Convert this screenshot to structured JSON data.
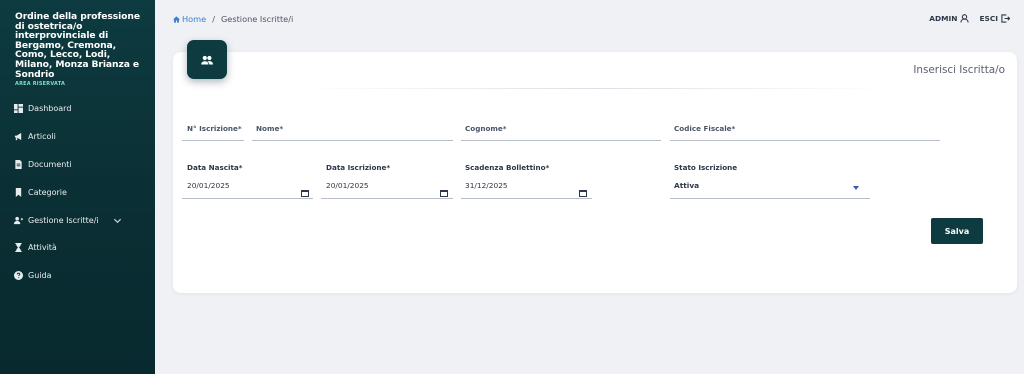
{
  "sidebar": {
    "brand_title": "Ordine della professione di ostetrica/o interprovinciale di Bergamo, Cremona, Como, Lecco, Lodi, Milano, Monza Brianza e Sondrio",
    "brand_sub": "AREA RISERVATA",
    "items": [
      {
        "label": "Dashboard",
        "icon": "dashboard-icon"
      },
      {
        "label": "Articoli",
        "icon": "megaphone-icon"
      },
      {
        "label": "Documenti",
        "icon": "document-icon"
      },
      {
        "label": "Categorie",
        "icon": "bookmark-icon"
      },
      {
        "label": "Gestione Iscritte/i",
        "icon": "users-icon"
      },
      {
        "label": "Attività",
        "icon": "hourglass-icon"
      },
      {
        "label": "Guida",
        "icon": "help-icon"
      }
    ]
  },
  "breadcrumb": {
    "home": "Home",
    "separator": "/",
    "current": "Gestione Iscritte/i"
  },
  "topbar": {
    "user": "ADMIN",
    "logout": "ESCI"
  },
  "card": {
    "title": "Inserisci Iscritta/o"
  },
  "form": {
    "n_iscrizione": {
      "label": "N° Iscrizione*",
      "value": ""
    },
    "nome": {
      "label": "Nome*",
      "value": ""
    },
    "cognome": {
      "label": "Cognome*",
      "value": ""
    },
    "codice_fiscale": {
      "label": "Codice Fiscale*",
      "value": ""
    },
    "data_nascita": {
      "label": "Data Nascita*",
      "value": "20/01/2025"
    },
    "data_iscrizione": {
      "label": "Data Iscrizione*",
      "value": "20/01/2025"
    },
    "scadenza_bollettino": {
      "label": "Scadenza Bollettino*",
      "value": "31/12/2025"
    },
    "stato_iscrizione": {
      "label": "Stato Iscrizione",
      "value": "Attiva"
    },
    "save_label": "Salva"
  },
  "colors": {
    "sidebar_bg": "#0d3b40",
    "accent": "#0d3b40",
    "link": "#3b7fd0",
    "page_bg": "#f0f1f5"
  }
}
